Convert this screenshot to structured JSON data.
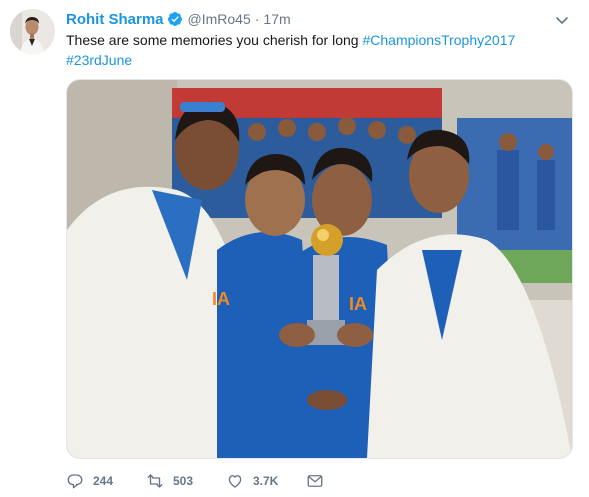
{
  "tweet": {
    "author_name": "Rohit Sharma",
    "author_handle": "@ImRo45",
    "separator": "·",
    "time": "17m",
    "text_prefix": "These are some memories you cherish for long ",
    "hashtags": [
      "#ChampionsTrophy2017",
      "#23rdJune"
    ],
    "media_description": "Photo of four cricketers in white blazers and blue jerseys holding the Champions Trophy",
    "actions": {
      "reply_count": "244",
      "retweet_count": "503",
      "like_count": "3.7K"
    }
  },
  "colors": {
    "link_blue": "#1b95e0",
    "muted_gray": "#657786",
    "text_dark": "#14171a",
    "jersey_blue": "#1e5fb8",
    "blazer_white": "#f2f0ea"
  },
  "icons": [
    "verified-badge-icon",
    "caret-down-icon",
    "reply-icon",
    "retweet-icon",
    "like-icon",
    "message-icon"
  ]
}
